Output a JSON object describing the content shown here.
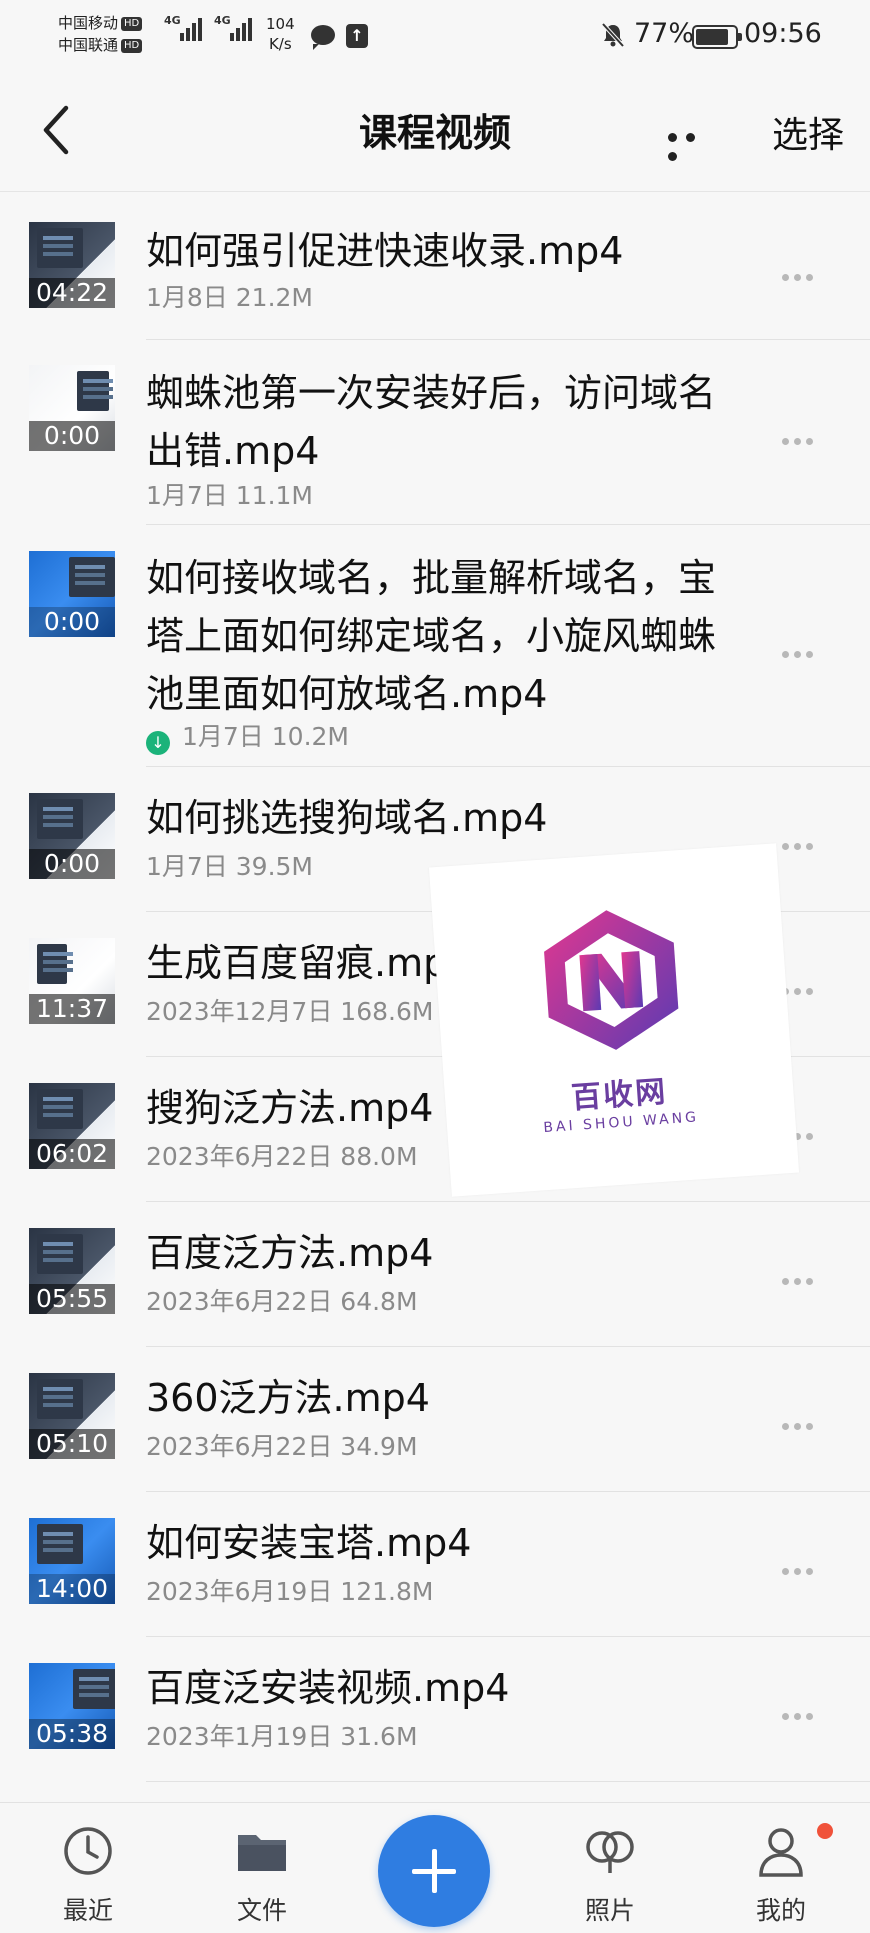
{
  "status_bar": {
    "carrier1": "中国移动",
    "carrier2": "中国联通",
    "hd": "HD",
    "gen1": "4G",
    "gen2": "4G",
    "net_speed_value": "104",
    "net_speed_unit": "K/s",
    "battery": "77%",
    "time": "09:56"
  },
  "header": {
    "title": "课程视频",
    "select_label": "选择"
  },
  "files": [
    {
      "name": "如何强引促进快速收录.mp4",
      "meta": "1月8日  21.2M",
      "duration": "04:22",
      "thumb": "dark"
    },
    {
      "name": "蜘蛛池第一次安装好后，访问域名出错.mp4",
      "meta": "1月7日  11.1M",
      "duration": "0:00",
      "thumb": "light"
    },
    {
      "name": "如何接收域名，批量解析域名，宝塔上面如何绑定域名，小旋风蜘蛛池里面如何放域名.mp4",
      "meta": "1月7日  10.2M",
      "duration": "0:00",
      "thumb": "blue",
      "downloaded": true
    },
    {
      "name": "如何挑选搜狗域名.mp4",
      "meta": "1月7日  39.5M",
      "duration": "0:00",
      "thumb": "dark"
    },
    {
      "name": "生成百度留痕.mp4",
      "meta": "2023年12月7日  168.6M",
      "duration": "11:37",
      "thumb": "light"
    },
    {
      "name": "搜狗泛方法.mp4",
      "meta": "2023年6月22日  88.0M",
      "duration": "06:02",
      "thumb": "dark"
    },
    {
      "name": "百度泛方法.mp4",
      "meta": "2023年6月22日  64.8M",
      "duration": "05:55",
      "thumb": "dark"
    },
    {
      "name": "360泛方法.mp4",
      "meta": "2023年6月22日  34.9M",
      "duration": "05:10",
      "thumb": "dark"
    },
    {
      "name": "如何安装宝塔.mp4",
      "meta": "2023年6月19日  121.8M",
      "duration": "14:00",
      "thumb": "blue"
    },
    {
      "name": "百度泛安装视频.mp4",
      "meta": "2023年1月19日  31.6M",
      "duration": "05:38",
      "thumb": "blue"
    }
  ],
  "watermark": {
    "text": "百收网",
    "sub": "BAI SHOU WANG"
  },
  "bottom_nav": {
    "recent": "最近",
    "files": "文件",
    "photos": "照片",
    "mine": "我的"
  },
  "colors": {
    "accent": "#2f7de1",
    "download_green": "#1bb37a",
    "notification_red": "#f0523a"
  }
}
